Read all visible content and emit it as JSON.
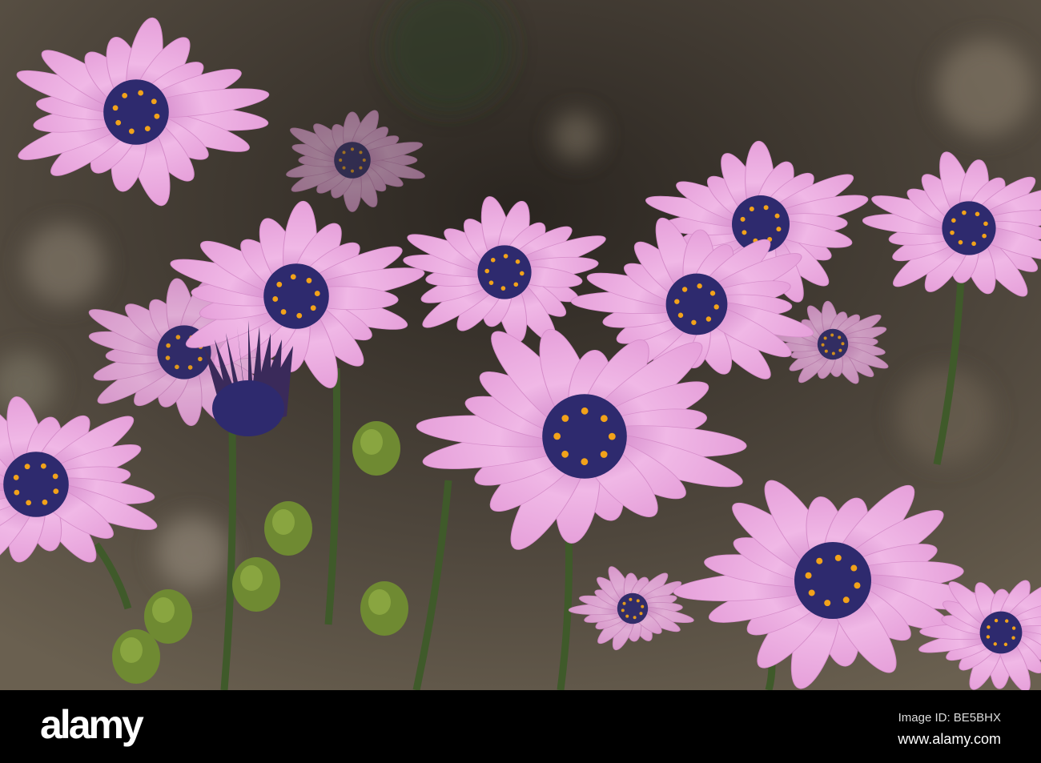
{
  "photo": {
    "subject": "Pink African daisies (Osteospermum)",
    "colors": {
      "petal": "#e8a6dc",
      "center": "#2e2a6e",
      "pollen": "#f2a21a",
      "background": "#4a4238",
      "stem": "#3f5a2a"
    }
  },
  "footer": {
    "logo": "alamy",
    "image_id": "Image ID: BE5BHX",
    "website": "www.alamy.com"
  }
}
